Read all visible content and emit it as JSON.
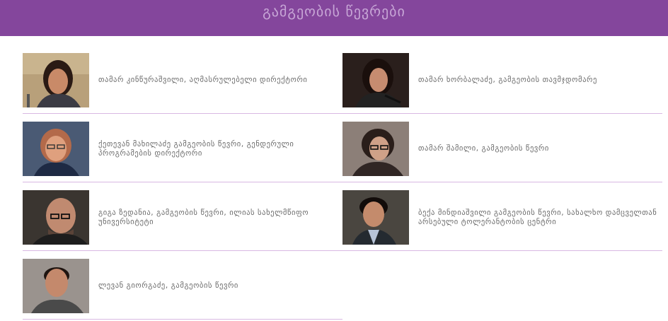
{
  "header": {
    "title": "გამგეობის წევრები",
    "color": "#84469c"
  },
  "members": [
    {
      "label": "თამარ კინწურაშვილი, აღმასრულებელი დირექტორი",
      "photo": "portrait-woman-short-dark-hair"
    },
    {
      "label": "თამარ ხორბალაძე, გამგეობის თავმჯდომარე",
      "photo": "portrait-woman-dark-hair-microphone"
    },
    {
      "label": "ქეთევან მახილაძე გამგეობის წევრი, გენდერული პროგრამების დირექტორი",
      "photo": "portrait-woman-short-hair-glasses"
    },
    {
      "label": "თამარ შამილი, გამგეობის წევრი",
      "photo": "portrait-woman-glasses"
    },
    {
      "label": "გიგა ზედანია, გამგეობის წევრი, ილიას სახელმწიფო უნივერსიტეტი",
      "photo": "portrait-man-bald-glasses"
    },
    {
      "label": "ბექა მინდიაშვილი გამგეობის წევრი, სახალხო დამცველთან არსებული ტოლერანტობის ცენტრი",
      "photo": "portrait-man-dark-hair-scarf"
    },
    {
      "label": "ლევან გიორგაძე, გამგეობის წევრი",
      "photo": "portrait-man-short-hair"
    }
  ]
}
